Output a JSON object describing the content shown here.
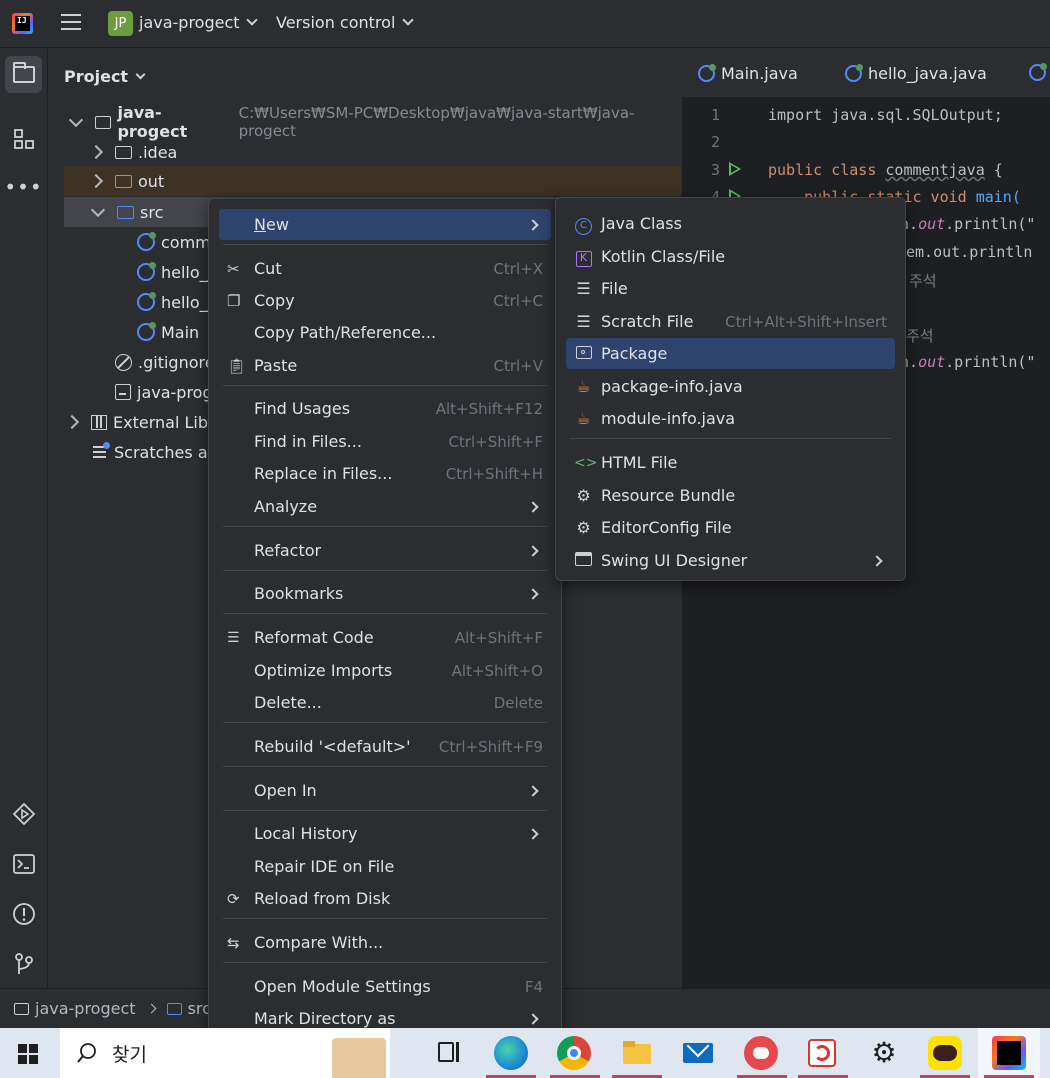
{
  "titlebar": {
    "logo_text": "IJ",
    "project_badge": "JP",
    "project_name": "java-progect",
    "vcs_label": "Version control"
  },
  "project_panel": {
    "title": "Project",
    "root": {
      "name": "java-progect",
      "path": "C:₩Users₩SM-PC₩Desktop₩java₩java-start₩java-progect"
    },
    "items": [
      {
        "label": ".idea"
      },
      {
        "label": "out"
      },
      {
        "label": "src"
      },
      {
        "label": "comm"
      },
      {
        "label": "hello_j"
      },
      {
        "label": "hello_j"
      },
      {
        "label": "Main"
      },
      {
        "label": ".gitignore"
      },
      {
        "label": "java-prog"
      },
      {
        "label": "External Libra"
      },
      {
        "label": "Scratches an"
      }
    ]
  },
  "editor": {
    "tabs": [
      {
        "label": "Main.java"
      },
      {
        "label": "hello_java.java"
      }
    ],
    "line_numbers": [
      "1",
      "2",
      "3",
      "4"
    ],
    "code": {
      "l1": "import java.sql.SQLOutput;",
      "l3_kw": "public class ",
      "l3_name": "commentjava",
      "l3_rest": " {",
      "l4_kw": "    public static void ",
      "l4_fn": "main(",
      "l5_a": "n.",
      "l5_b": "out",
      "l5_c": ".println(\"",
      "l6": "em.out.println",
      "l7": "주석",
      "l9": "주석",
      "l10_a": "n.",
      "l10_b": "out",
      "l10_c": ".println(\""
    }
  },
  "statusbar": {
    "crumb1": "java-progect",
    "crumb2": "src"
  },
  "context_menu": {
    "new": "New",
    "cut": "Cut",
    "cut_sc": "Ctrl+X",
    "copy": "Copy",
    "copy_sc": "Ctrl+C",
    "copy_path": "Copy Path/Reference...",
    "paste": "Paste",
    "paste_sc": "Ctrl+V",
    "find_usages": "Find Usages",
    "find_usages_sc": "Alt+Shift+F12",
    "find_in_files": "Find in Files...",
    "find_in_files_sc": "Ctrl+Shift+F",
    "replace_in_files": "Replace in Files...",
    "replace_in_files_sc": "Ctrl+Shift+H",
    "analyze": "Analyze",
    "refactor": "Refactor",
    "bookmarks": "Bookmarks",
    "reformat": "Reformat Code",
    "reformat_sc": "Alt+Shift+F",
    "optimize": "Optimize Imports",
    "optimize_sc": "Alt+Shift+O",
    "delete": "Delete...",
    "delete_sc": "Delete",
    "rebuild": "Rebuild '<default>'",
    "rebuild_sc": "Ctrl+Shift+F9",
    "open_in": "Open In",
    "local_history": "Local History",
    "repair": "Repair IDE on File",
    "reload": "Reload from Disk",
    "compare": "Compare With...",
    "module_settings": "Open Module Settings",
    "module_settings_sc": "F4",
    "mark_dir": "Mark Directory as"
  },
  "new_submenu": {
    "java_class": "Java Class",
    "kotlin": "Kotlin Class/File",
    "file": "File",
    "scratch": "Scratch File",
    "scratch_sc": "Ctrl+Alt+Shift+Insert",
    "package": "Package",
    "package_info": "package-info.java",
    "module_info": "module-info.java",
    "html": "HTML File",
    "resource_bundle": "Resource Bundle",
    "editorconfig": "EditorConfig File",
    "swing": "Swing UI Designer"
  },
  "taskbar": {
    "search_text": "찾기"
  }
}
